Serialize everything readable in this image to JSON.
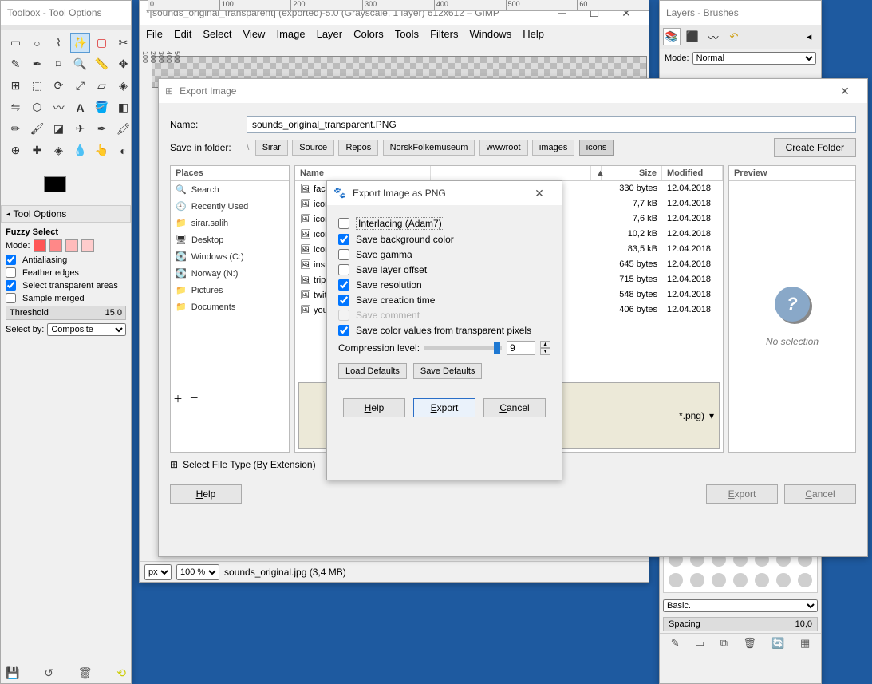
{
  "toolbox": {
    "title": "Toolbox - Tool Options",
    "options_header": "Tool Options",
    "selected_tool": "Fuzzy Select",
    "mode_label": "Mode:",
    "antialiasing": "Antialiasing",
    "feather": "Feather edges",
    "select_transparent": "Select transparent areas",
    "sample_merged": "Sample merged",
    "threshold_label": "Threshold",
    "threshold_value": "15,0",
    "selectby_label": "Select by:",
    "selectby_value": "Composite"
  },
  "gimp": {
    "title": "*[sounds_original_transparent] (exported)-5.0 (Grayscale, 1 layer) 612x612 – GIMP",
    "menu": [
      "File",
      "Edit",
      "Select",
      "View",
      "Image",
      "Layer",
      "Colors",
      "Tools",
      "Filters",
      "Windows",
      "Help"
    ],
    "unit": "px",
    "zoom": "100 %",
    "status": "sounds_original.jpg (3,4 MB)"
  },
  "export": {
    "title": "Export Image",
    "name_label": "Name:",
    "name_value": "sounds_original_transparent.PNG",
    "folder_label": "Save in folder:",
    "crumbs": [
      "Sirar",
      "Source",
      "Repos",
      "NorskFolkemuseum",
      "wwwroot",
      "images",
      "icons"
    ],
    "create_folder": "Create Folder",
    "places_hdr": "Places",
    "places": [
      "Search",
      "Recently Used",
      "sirar.salih",
      "Desktop",
      "Windows (C:)",
      "Norway (N:)",
      "Pictures",
      "Documents"
    ],
    "name_hdr": "Name",
    "size_hdr": "Size",
    "mod_hdr": "Modified",
    "files": [
      {
        "name": "faceb",
        "size": "330 bytes",
        "mod": "12.04.2018"
      },
      {
        "name": "icons",
        "size": "7,7 kB",
        "mod": "12.04.2018"
      },
      {
        "name": "icons",
        "size": "7,6 kB",
        "mod": "12.04.2018"
      },
      {
        "name": "icons",
        "size": "10,2 kB",
        "mod": "12.04.2018"
      },
      {
        "name": "icons",
        "size": "83,5 kB",
        "mod": "12.04.2018"
      },
      {
        "name": "insta",
        "size": "645 bytes",
        "mod": "12.04.2018"
      },
      {
        "name": "tripa",
        "size": "715 bytes",
        "mod": "12.04.2018"
      },
      {
        "name": "twitt",
        "size": "548 bytes",
        "mod": "12.04.2018"
      },
      {
        "name": "yout",
        "size": "406 bytes",
        "mod": "12.04.2018"
      }
    ],
    "preview_hdr": "Preview",
    "preview_text": "No selection",
    "filetype_ext": "*.png)",
    "select_file_type": "Select File Type (By Extension)",
    "help": "Help",
    "export_btn": "Export",
    "cancel": "Cancel"
  },
  "png": {
    "title": "Export Image as PNG",
    "interlacing": "Interlacing (Adam7)",
    "save_bg": "Save background color",
    "save_gamma": "Save gamma",
    "save_layer_offset": "Save layer offset",
    "save_resolution": "Save resolution",
    "save_creation": "Save creation time",
    "save_comment": "Save comment",
    "save_color_values": "Save color values from transparent pixels",
    "compression_label": "Compression level:",
    "compression_value": "9",
    "load_defaults": "Load Defaults",
    "save_defaults": "Save Defaults",
    "help": "Help",
    "export": "Export",
    "cancel": "Cancel"
  },
  "layers": {
    "title": "Layers - Brushes",
    "mode_label": "Mode:",
    "mode_value": "Normal",
    "brush_value": "Basic.",
    "spacing_label": "Spacing",
    "spacing_value": "10,0"
  }
}
